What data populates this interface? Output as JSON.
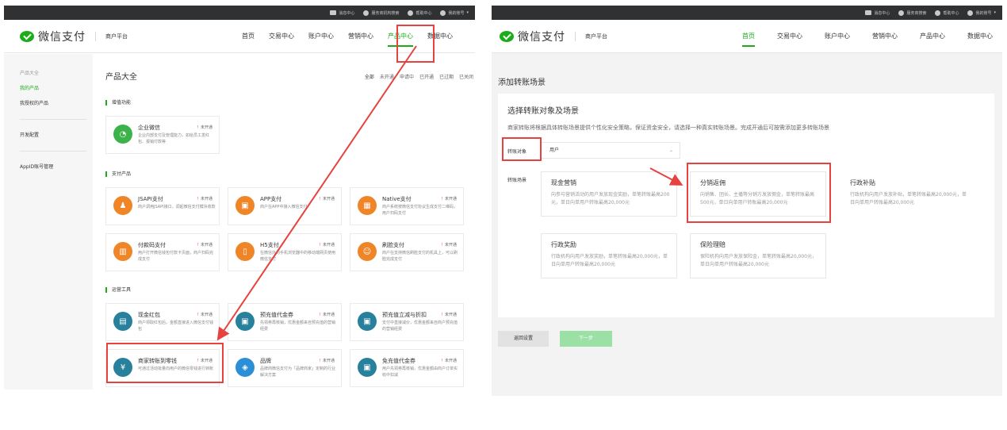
{
  "left": {
    "topbar": [
      {
        "icon": "message-icon",
        "label": "消息中心"
      },
      {
        "icon": "service-icon",
        "label": "服务商机构搜索"
      },
      {
        "icon": "help-icon",
        "label": "帮助中心"
      },
      {
        "icon": "user-icon",
        "label": "我的账号"
      }
    ],
    "brand": {
      "logo": "微信支付",
      "sub": "商户平台"
    },
    "nav": [
      "首页",
      "交易中心",
      "账户中心",
      "营销中心",
      "产品中心",
      "数据中心"
    ],
    "nav_active": "产品中心",
    "sidebar": [
      "产品大全",
      "我的产品",
      "我授权的产品",
      "开发配置",
      "AppID账号管理"
    ],
    "page_title": "产品大全",
    "filters": [
      "全部",
      "未开通",
      "申请中",
      "已开通",
      "已过期",
      "已关闭"
    ],
    "sections": {
      "s1": "增值功能",
      "s2": "支付产品",
      "s3": "运营工具"
    },
    "status_mark": "！",
    "cards": [
      {
        "name": "企业微信",
        "status": "未开通",
        "desc": "企业内部支付及管理能力，如给员工发红包、报销付款等",
        "icon": "wecom-icon"
      },
      {
        "name": "JSAPI支付",
        "status": "未开通",
        "desc": "商户调用JSAPI接口，调起微信支付模块收款",
        "icon": "jsapi-icon"
      },
      {
        "name": "APP支付",
        "status": "未开通",
        "desc": "商户在APP中接入微信支付",
        "icon": "app-icon"
      },
      {
        "name": "Native支付",
        "status": "未开通",
        "desc": "商户系统按微信支付协议生成支付二维码，用户扫码支付",
        "icon": "native-icon"
      },
      {
        "name": "付款码支付",
        "status": "未开通",
        "desc": "用户打开微信钱包付款卡页面，商户扫码完成支付",
        "icon": "barcode-icon"
      },
      {
        "name": "H5支付",
        "status": "未开通",
        "desc": "在微信外的手机浏览器中的移动端网页使用微信支付",
        "icon": "h5-icon"
      },
      {
        "name": "刷脸支付",
        "status": "未开通",
        "desc": "商户在支持微信刷脸支付的机具上，可以刷脸完成支付",
        "icon": "face-icon"
      },
      {
        "name": "现金红包",
        "status": "未开通",
        "desc": "商户领取红包后，金额直接进入微信支付钱包",
        "icon": "red-packet-icon"
      },
      {
        "name": "预充值代金券",
        "status": "未开通",
        "desc": "先领券再核销，优惠金额来自预充值的营销经费",
        "icon": "voucher-icon"
      },
      {
        "name": "预充值立减与折扣",
        "status": "未开通",
        "desc": "支付中直接减价，优惠金额来自商户预充值的营销经费",
        "icon": "discount-icon"
      },
      {
        "name": "商家转账到零钱",
        "status": "未开通",
        "desc": "可通过活动批量向用户的微信零钱进行转账",
        "icon": "transfer-icon"
      },
      {
        "name": "品牌",
        "status": "未开通",
        "desc": "品牌商微信支付为「品牌商家」定制的行业解决方案",
        "icon": "brand-icon"
      },
      {
        "name": "免充值代金券",
        "status": "未开通",
        "desc": "用户先领券再核销，优惠金额由商户订单实收中扣减",
        "icon": "free-voucher-icon"
      }
    ]
  },
  "right": {
    "topbar": [
      {
        "icon": "message-icon",
        "label": "消息中心"
      },
      {
        "icon": "service-icon",
        "label": "服务商搜索"
      },
      {
        "icon": "help-icon",
        "label": "帮助中心"
      },
      {
        "icon": "user-icon",
        "label": "我的账号"
      }
    ],
    "brand": {
      "logo": "微信支付",
      "sub": "商户平台"
    },
    "nav": [
      "首页",
      "交易中心",
      "账户中心",
      "营销中心",
      "产品中心",
      "数据中心"
    ],
    "nav_active": "首页",
    "page_title": "添加转账场景",
    "box_title": "选择转账对象及场景",
    "box_desc": "商家转账将根据具体转账场景提供个性化安全策略，保证资金安全，请选择一种真实转账场景。完成开通后可按需添加更多转账场景",
    "target_label": "转账对象",
    "target_value": "用户",
    "scene_label": "转账场景",
    "scenes": [
      {
        "name": "现金营销",
        "desc": "向参与营销活动的用户发放现金奖励，单笔转账最高200元，单日向单用户转账最高20,000元"
      },
      {
        "name": "分销返佣",
        "desc": "向销售、团长、主播等分销方发放佣金，单笔转账最高500元，单日向单用户转账最高20,000元"
      },
      {
        "name": "行政补贴",
        "desc": "行政机构向用户发放补贴，单笔转账最高20,000元，单日向单用户转账最高20,000元"
      },
      {
        "name": "行政奖励",
        "desc": "行政机构向用户发放奖励，单笔转账最高20,000元，单日向单用户转账最高20,000元"
      },
      {
        "name": "保险理赔",
        "desc": "保险机构向用户发放保险金，单笔转账最高20,000元，单日向单用户转账最高20,000元"
      }
    ],
    "back_label": "返回设置",
    "next_label": "下一步"
  },
  "colors": {
    "brand_green": "#1aad19",
    "highlight_red": "#e64340",
    "topbar": "#2f3133"
  }
}
